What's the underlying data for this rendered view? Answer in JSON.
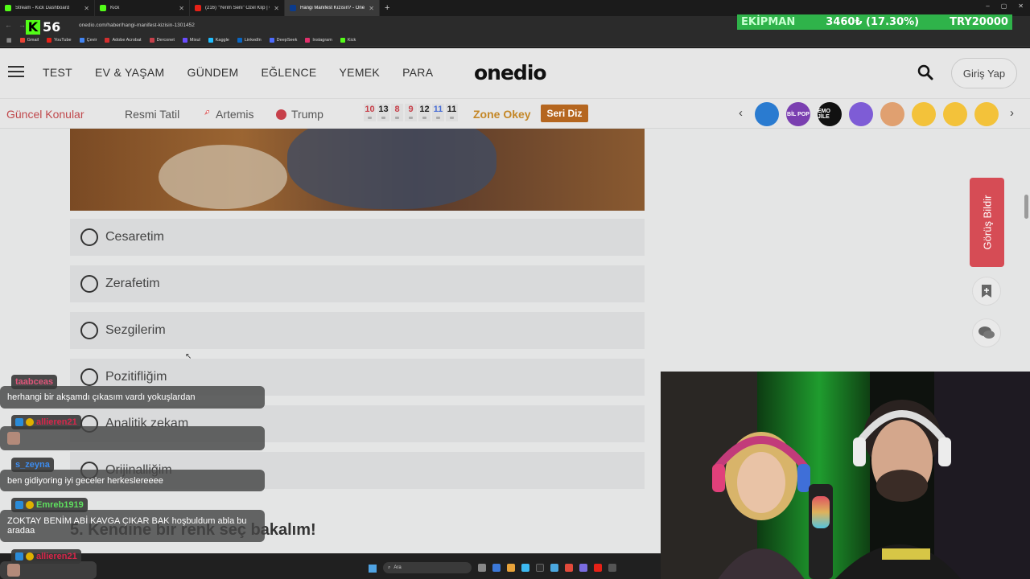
{
  "browser": {
    "tabs": [
      {
        "title": "Stream - Kick Dashboard",
        "color": "#53fc18",
        "active": false
      },
      {
        "title": "Kick",
        "color": "#53fc18",
        "active": false
      },
      {
        "title": "(216) \"Yerim Seni\" Özel Klip | G",
        "color": "#e62117",
        "active": false
      },
      {
        "title": "Hangi Manifest Kızısın? - Oned",
        "color": "#0b3b8c",
        "active": true
      }
    ],
    "new_tab": "+",
    "url": "onedio.com/haber/hangi-manifest-kizisin-1301452",
    "bookmarks": [
      {
        "label": "Gmail",
        "color": "#ea4335"
      },
      {
        "label": "YouTube",
        "color": "#e62117"
      },
      {
        "label": "Çevir",
        "color": "#4285f4"
      },
      {
        "label": "Adobe Acrobat",
        "color": "#d32f2f"
      },
      {
        "label": "Derconet",
        "color": "#c7404a"
      },
      {
        "label": "Mixul",
        "color": "#6a4cff"
      },
      {
        "label": "Kaggle",
        "color": "#20beff"
      },
      {
        "label": "LinkedIn",
        "color": "#0a66c2"
      },
      {
        "label": "DeepSeek",
        "color": "#4d6bfe"
      },
      {
        "label": "Instagram",
        "color": "#e1306c"
      },
      {
        "label": "Kick",
        "color": "#53fc18"
      }
    ]
  },
  "overlay": {
    "kick_logo": "K",
    "viewer_count": "56",
    "ticker_label": "EKİPMAN",
    "ticker_amount": "3460₺ (17.30%)",
    "ticker_goal": "TRY20000"
  },
  "site": {
    "brand": "onedio",
    "nav": [
      "TEST",
      "EV & YAŞAM",
      "GÜNDEM",
      "EĞLENCE",
      "YEMEK",
      "PARA"
    ],
    "login": "Giriş Yap",
    "topics_title": "Güncel Konular",
    "topics": [
      "Resmi Tatil",
      "Artemis",
      "Trump"
    ],
    "numbers": [
      {
        "n": "10",
        "color": "#c7404a"
      },
      {
        "n": "13",
        "color": "#222222"
      },
      {
        "n": "8",
        "color": "#c7404a"
      },
      {
        "n": "9",
        "color": "#c7404a"
      },
      {
        "n": "12",
        "color": "#222222"
      },
      {
        "n": "11",
        "color": "#4a6fd6"
      },
      {
        "n": "11",
        "color": "#222222"
      }
    ],
    "zone_okey": "Zone Okey",
    "seri_diz": "Seri Diz",
    "reactions": [
      {
        "label": "",
        "color": "#2a7bd0"
      },
      {
        "label": "BİL POP",
        "color": "#7a3fb0"
      },
      {
        "label": "EMO JİLE",
        "color": "#111111"
      },
      {
        "label": "",
        "color": "#7e5cd6"
      },
      {
        "label": "",
        "color": "#e0a070"
      },
      {
        "label": "",
        "color": "#f3c23a"
      },
      {
        "label": "",
        "color": "#f3c23a"
      },
      {
        "label": "",
        "color": "#f3c23a"
      }
    ],
    "options": [
      "Cesaretim",
      "Zerafetim",
      "Sezgilerim",
      "Pozitifliğim",
      "Analitik zekam",
      "Orijinalliğim"
    ],
    "next_question": "5. Kendine bir renk seç bakalım!",
    "feedback": "Görüş Bildir"
  },
  "chat": [
    {
      "user": "taabceas",
      "user_color": "#e0557a",
      "text": "herhangi bir akşamdı çıkasım vardı yokuşlardan"
    },
    {
      "user": "allieren21",
      "user_color": "#d6264a",
      "text": ""
    },
    {
      "user": "s_zeyna",
      "user_color": "#3d8df0",
      "text": "ben gidiyoring iyi geceler herkeslereeee"
    },
    {
      "user": "Emreb1919",
      "user_color": "#5fe05f",
      "text": "ZOKTAY BENİM ABİ KAVGA ÇIKAR BAK hoşbuldum abla bu aradaa"
    },
    {
      "user": "allieren21",
      "user_color": "#d6264a",
      "text": ""
    }
  ],
  "taskbar": {
    "search_placeholder": "Ara"
  }
}
